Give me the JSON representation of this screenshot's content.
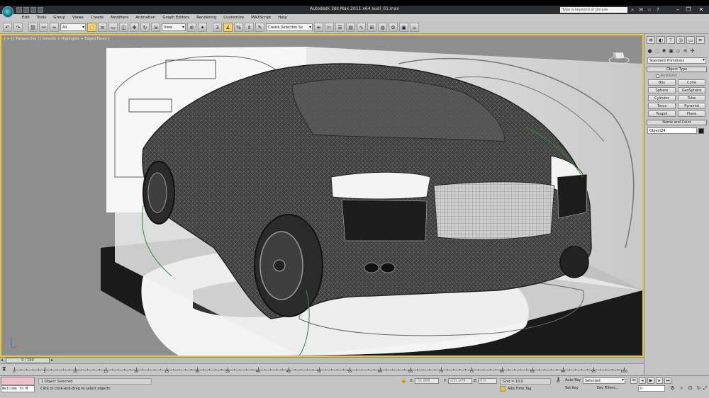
{
  "app": {
    "title": "Autodesk 3ds Max 2011 x64      audi_01.max",
    "search_placeholder": "Type a keyword or phrase"
  },
  "menu": [
    "Edit",
    "Tools",
    "Group",
    "Views",
    "Create",
    "Modifiers",
    "Animation",
    "Graph Editors",
    "Rendering",
    "Customize",
    "MAXScript",
    "Help"
  ],
  "toolbar": {
    "selection_filter": "All",
    "ref_coord": "View",
    "named_selection": "Create Selection Se"
  },
  "viewport": {
    "label": "[ + ] [ Perspective ] [ Smooth + Highlights + Edged Faces ]"
  },
  "command_panel": {
    "primitive_type": "Standard Primitives",
    "object_type_header": "Object Type",
    "autogrid_label": "AutoGrid",
    "buttons": [
      "Box",
      "Cone",
      "Sphere",
      "GeoSphere",
      "Cylinder",
      "Tube",
      "Torus",
      "Pyramid",
      "Teapot",
      "Plane"
    ],
    "name_color_header": "Name and Color",
    "object_name": "Object24",
    "object_color": "#1a1a1a"
  },
  "timeline": {
    "slider_label": "0 / 100",
    "ticks": [
      "0",
      "5",
      "10",
      "15",
      "20",
      "25",
      "30",
      "35",
      "40",
      "45",
      "50",
      "55",
      "60",
      "65",
      "70",
      "75",
      "80",
      "85",
      "90",
      "95",
      "100"
    ]
  },
  "status": {
    "listener_text": "Welcome to M",
    "selection": "1 Object Selected",
    "prompt": "Click or click-and-drag to select objects",
    "x_value": "-31,988",
    "y_value": "-231,978",
    "z_value": "0,0",
    "x_label": "X:",
    "y_label": "Y:",
    "z_label": "Z:",
    "grid": "Grid = 10,0",
    "add_time_tag": "Add Time Tag",
    "auto_key": "Auto Key",
    "set_key": "Set Key",
    "key_mode": "Selected",
    "key_filters": "Key Filters...",
    "frame": "0"
  }
}
